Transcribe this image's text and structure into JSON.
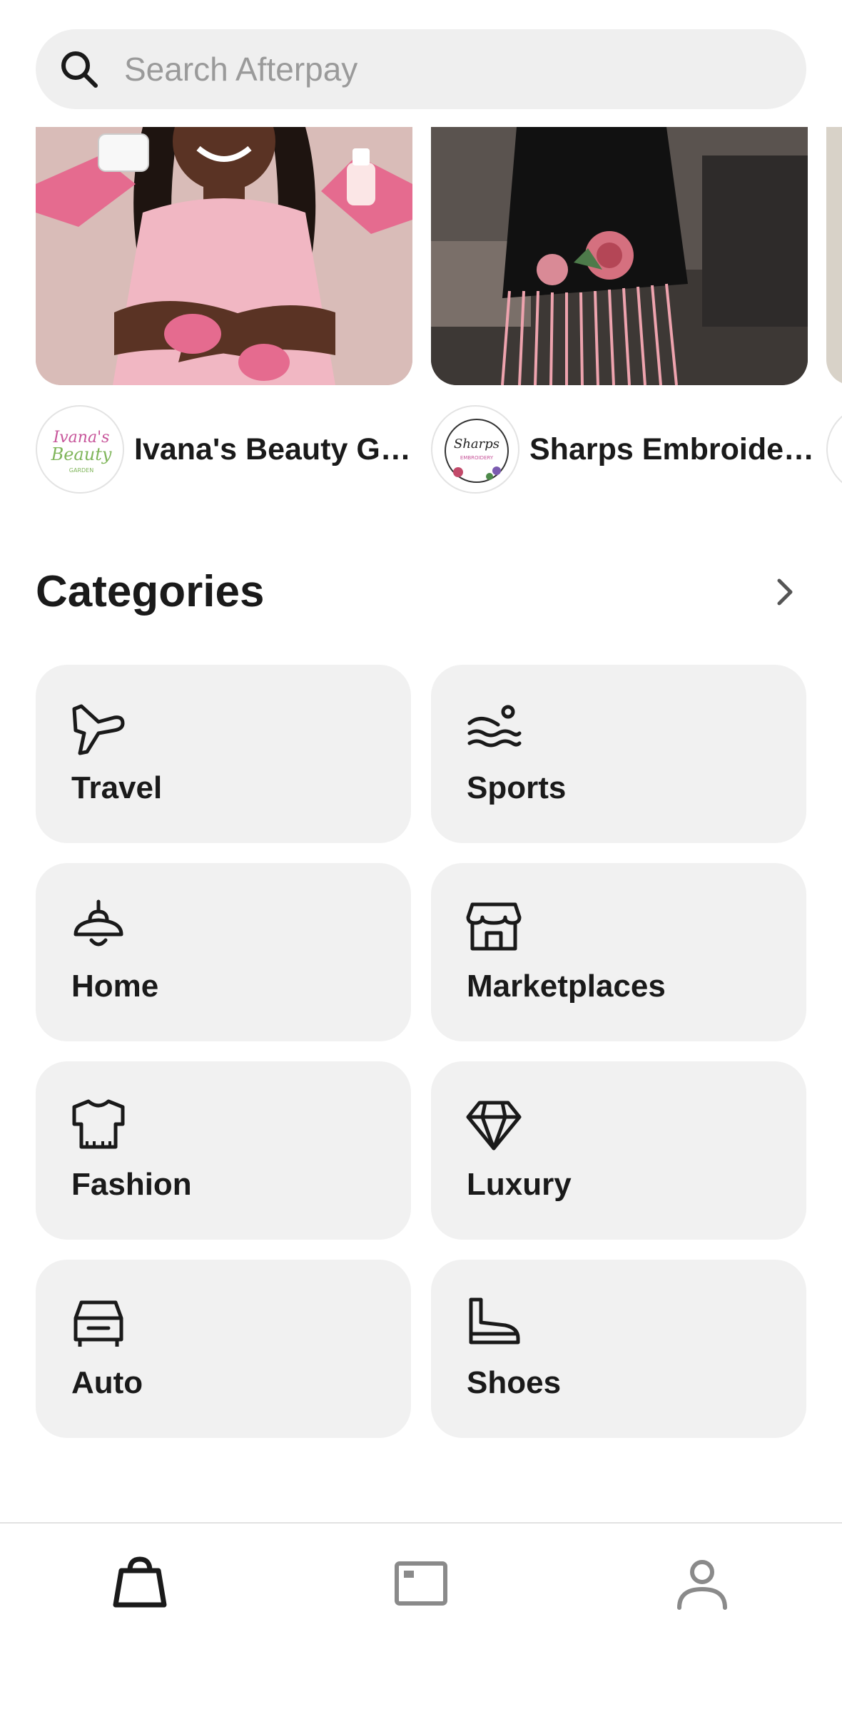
{
  "search": {
    "placeholder": "Search Afterpay",
    "icon": "search-icon"
  },
  "stores": [
    {
      "name": "Ivana's Beauty Ga…",
      "logo_icon": "store-logo-ivanas-beauty-garden"
    },
    {
      "name": "Sharps Embroider…",
      "logo_icon": "store-logo-sharps-embroidery"
    }
  ],
  "categories": {
    "title": "Categories",
    "items": [
      {
        "label": "Travel",
        "icon": "airplane-icon"
      },
      {
        "label": "Sports",
        "icon": "swimmer-icon"
      },
      {
        "label": "Home",
        "icon": "lamp-icon"
      },
      {
        "label": "Marketplaces",
        "icon": "storefront-icon"
      },
      {
        "label": "Fashion",
        "icon": "shirt-icon"
      },
      {
        "label": "Luxury",
        "icon": "diamond-icon"
      },
      {
        "label": "Auto",
        "icon": "car-icon"
      },
      {
        "label": "Shoes",
        "icon": "shoe-icon"
      }
    ]
  },
  "bottom_nav": {
    "items": [
      {
        "icon": "shopping-bag-icon",
        "active": true
      },
      {
        "icon": "card-icon",
        "active": false
      },
      {
        "icon": "profile-icon",
        "active": false
      }
    ]
  },
  "colors": {
    "active": "#1a1a1a",
    "inactive": "#8a8a8a",
    "tile_bg": "#f1f1f1",
    "search_bg": "#efefef"
  }
}
